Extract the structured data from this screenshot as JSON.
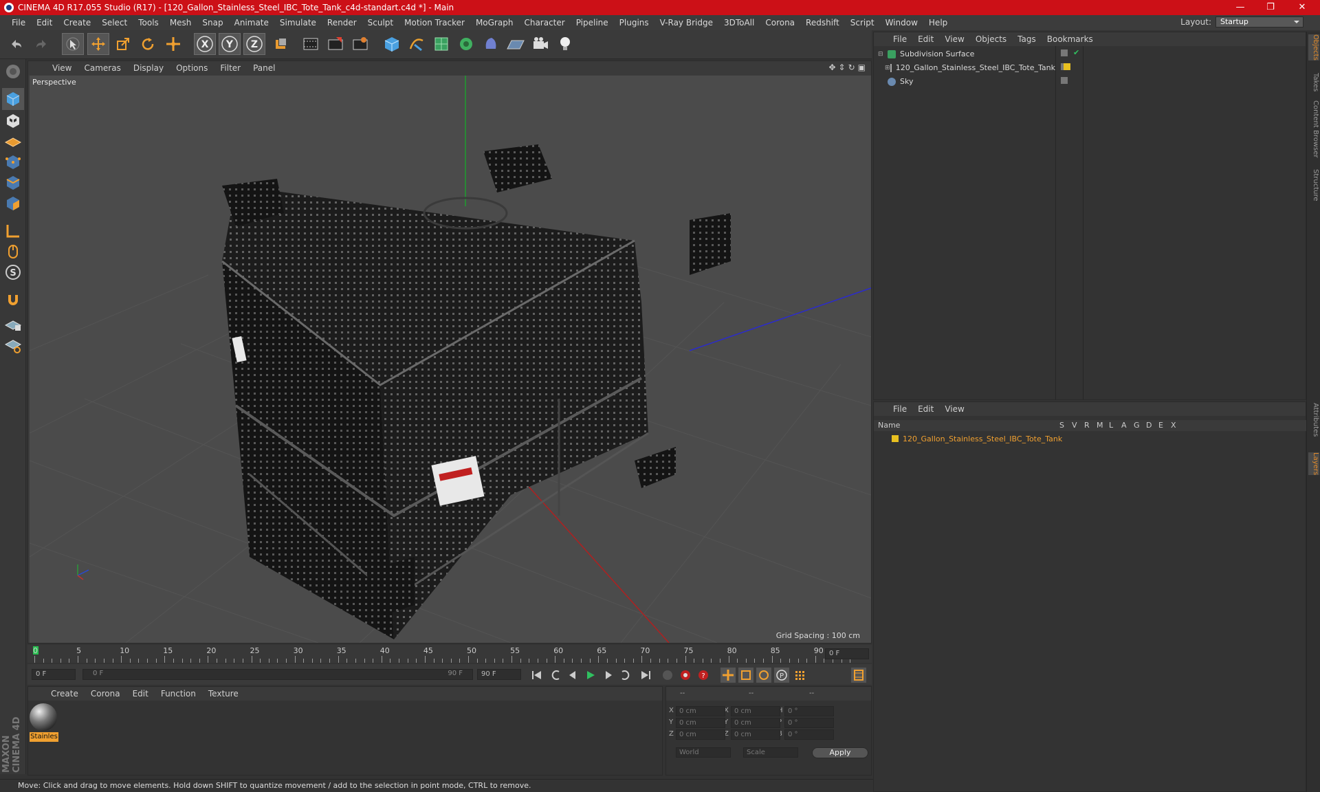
{
  "window": {
    "title": "CINEMA 4D R17.055 Studio (R17) - [120_Gallon_Stainless_Steel_IBC_Tote_Tank_c4d-standart.c4d *] - Main",
    "min": "—",
    "max": "❐",
    "close": "✕"
  },
  "menubar": [
    "File",
    "Edit",
    "Create",
    "Select",
    "Tools",
    "Mesh",
    "Snap",
    "Animate",
    "Simulate",
    "Render",
    "Sculpt",
    "Motion Tracker",
    "MoGraph",
    "Character",
    "Pipeline",
    "Plugins",
    "V-Ray Bridge",
    "3DToAll",
    "Corona",
    "Redshift",
    "Script",
    "Window",
    "Help"
  ],
  "layout": {
    "label": "Layout:",
    "value": "Startup"
  },
  "toolbar": {
    "x": "X",
    "y": "Y",
    "z": "Z"
  },
  "viewport": {
    "menu": [
      "View",
      "Cameras",
      "Display",
      "Options",
      "Filter",
      "Panel"
    ],
    "label": "Perspective",
    "grid_spacing": "Grid Spacing : 100 cm"
  },
  "timeline": {
    "ticks": [
      "0",
      "5",
      "10",
      "15",
      "20",
      "25",
      "30",
      "35",
      "40",
      "45",
      "50",
      "55",
      "60",
      "65",
      "70",
      "75",
      "80",
      "85",
      "90"
    ],
    "current": "0 F"
  },
  "playback": {
    "start": "0 F",
    "range_start": "0 F",
    "range_end": "90 F",
    "end": "90 F"
  },
  "material": {
    "menu": [
      "Create",
      "Corona",
      "Edit",
      "Function",
      "Texture"
    ],
    "items": [
      {
        "label": "Stainles"
      }
    ]
  },
  "coords": {
    "hdr1": "--",
    "hdr2": "--",
    "hdr3": "--",
    "rows": [
      {
        "a": "X",
        "v1": "0 cm",
        "b": "X",
        "v2": "0 cm",
        "c": "H",
        "v3": "0 °"
      },
      {
        "a": "Y",
        "v1": "0 cm",
        "b": "Y",
        "v2": "0 cm",
        "c": "P",
        "v3": "0 °"
      },
      {
        "a": "Z",
        "v1": "0 cm",
        "b": "Z",
        "v2": "0 cm",
        "c": "B",
        "v3": "0 °"
      }
    ],
    "world": "World",
    "scale": "Scale",
    "apply": "Apply"
  },
  "objects": {
    "menu": [
      "File",
      "Edit",
      "View",
      "Objects",
      "Tags",
      "Bookmarks"
    ],
    "items": [
      {
        "name": "Subdivision Surface"
      },
      {
        "name": "120_Gallon_Stainless_Steel_IBC_Tote_Tank"
      },
      {
        "name": "Sky"
      }
    ]
  },
  "layers": {
    "menu": [
      "File",
      "Edit",
      "View"
    ],
    "cols": [
      "Name",
      "S",
      "V",
      "R",
      "M",
      "L",
      "A",
      "G",
      "D",
      "E",
      "X"
    ],
    "items": [
      {
        "name": "120_Gallon_Stainless_Steel_IBC_Tote_Tank"
      }
    ]
  },
  "righttabs": [
    "Objects",
    "Takes",
    "Content Browser",
    "Structure",
    "Attributes",
    "Layers"
  ],
  "status": "Move: Click and drag to move elements. Hold down SHIFT to quantize movement / add to the selection in point mode, CTRL to remove.",
  "brand": "MAXON CINEMA 4D",
  "colors": {
    "accent": "#f0a030",
    "title": "#cc1017",
    "layer": "#e8c020"
  }
}
